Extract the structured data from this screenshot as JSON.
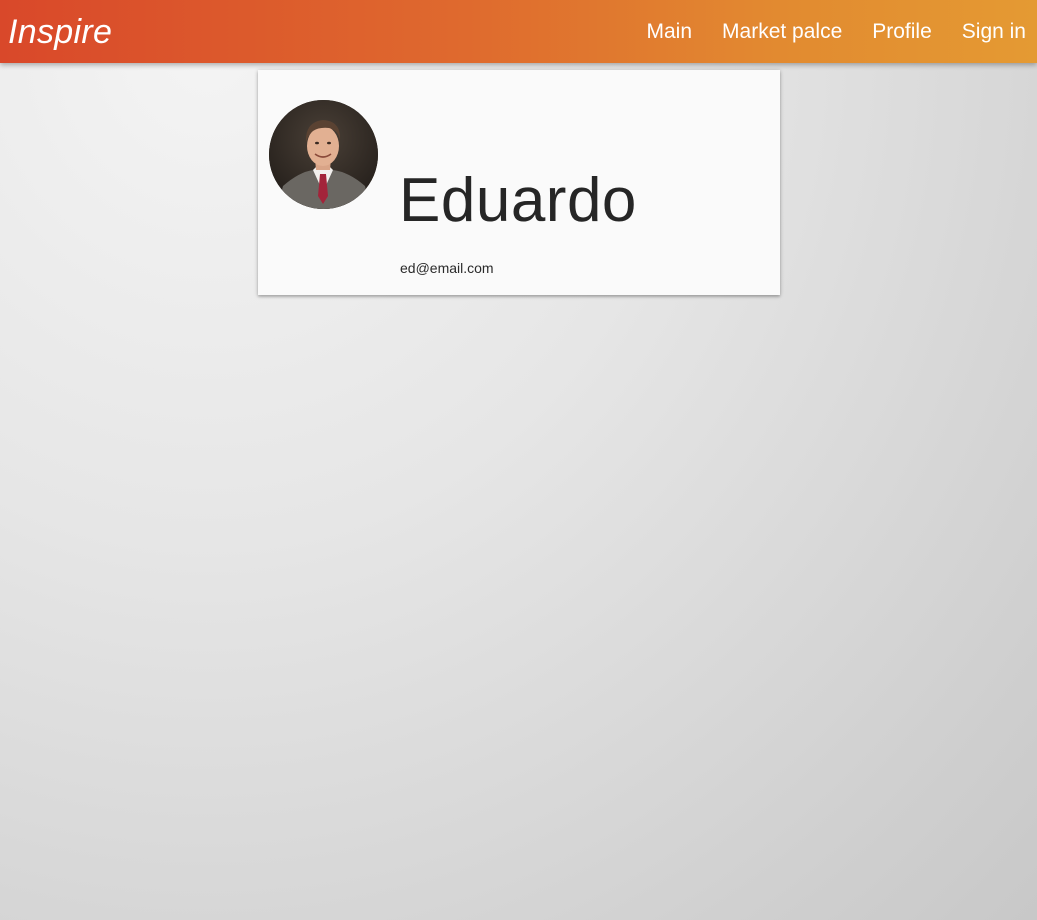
{
  "navbar": {
    "brand": "Inspire",
    "links": [
      {
        "label": "Main"
      },
      {
        "label": "Market palce"
      },
      {
        "label": "Profile"
      },
      {
        "label": "Sign in"
      }
    ],
    "gradient_colors": [
      "#d9482a",
      "#e49a33"
    ]
  },
  "profile": {
    "avatar_icon": "person-photo",
    "name": "Eduardo",
    "email": "ed@email.com"
  }
}
